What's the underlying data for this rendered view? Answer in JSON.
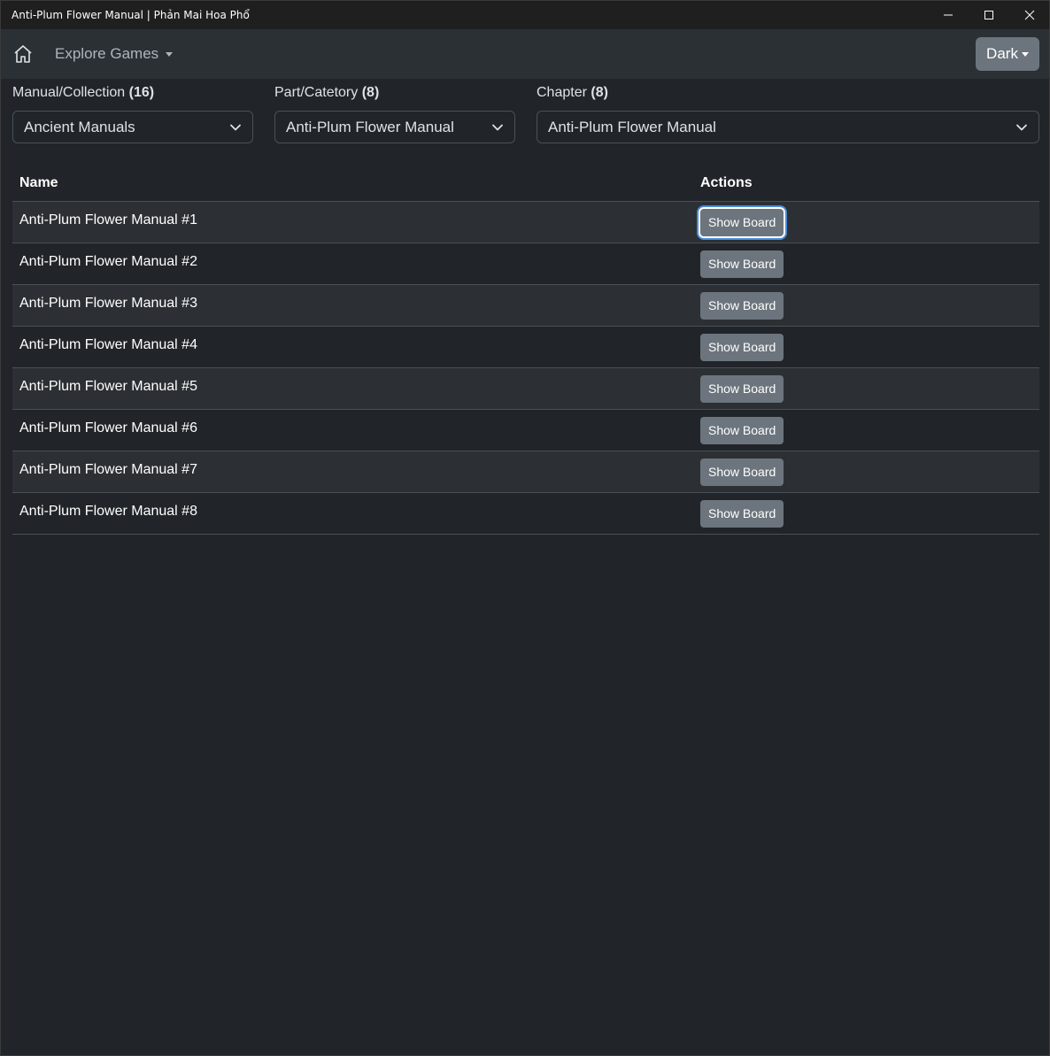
{
  "window": {
    "title": "Anti-Plum Flower Manual | Phản Mai Hoa Phổ",
    "controls": [
      "minimize-icon",
      "maximize-icon",
      "close-icon"
    ]
  },
  "navbar": {
    "home_icon": "home-icon",
    "explore_label": "Explore Games",
    "theme_label": "Dark"
  },
  "filters": {
    "manual": {
      "label": "Manual/Collection",
      "count": "(16)",
      "selected": "Ancient Manuals"
    },
    "part": {
      "label": "Part/Catetory",
      "count": "(8)",
      "selected": "Anti-Plum Flower Manual"
    },
    "chapter": {
      "label": "Chapter",
      "count": "(8)",
      "selected": "Anti-Plum Flower Manual"
    }
  },
  "table": {
    "headers": {
      "name": "Name",
      "actions": "Actions"
    },
    "action_label": "Show Board",
    "rows": [
      {
        "name": "Anti-Plum Flower Manual #1"
      },
      {
        "name": "Anti-Plum Flower Manual #2"
      },
      {
        "name": "Anti-Plum Flower Manual #3"
      },
      {
        "name": "Anti-Plum Flower Manual #4"
      },
      {
        "name": "Anti-Plum Flower Manual #5"
      },
      {
        "name": "Anti-Plum Flower Manual #6"
      },
      {
        "name": "Anti-Plum Flower Manual #7"
      },
      {
        "name": "Anti-Plum Flower Manual #8"
      }
    ]
  },
  "colors": {
    "background": "#212529",
    "navbar": "#2b3035",
    "button": "#6c757d",
    "focus_ring": "#4d8bd8"
  }
}
